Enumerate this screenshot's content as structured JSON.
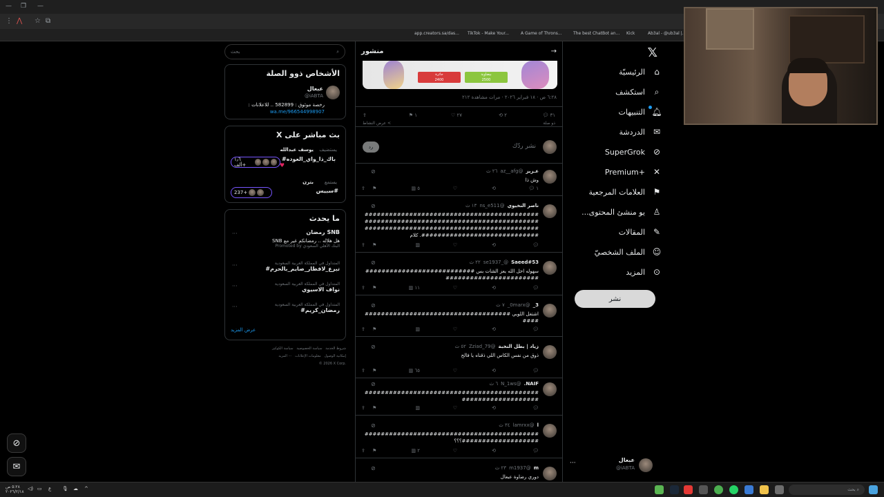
{
  "browser": {
    "bookmarks": [
      "app.creators.sa/das...",
      "TikTok - Make Your...",
      "A Game of Throns...",
      "The best ChatBot an...",
      "Kick",
      "Ab3al - @ub3al |..."
    ]
  },
  "nav": {
    "items": [
      {
        "label": "الرئيسيّة",
        "icon": "home-icon"
      },
      {
        "label": "استكشف",
        "icon": "search-icon"
      },
      {
        "label": "التنبيهات",
        "icon": "bell-icon"
      },
      {
        "label": "الدردشة",
        "icon": "mail-icon"
      },
      {
        "label": "SuperGrok",
        "icon": "grok-icon"
      },
      {
        "label": "Premium+",
        "icon": "x-icon"
      },
      {
        "label": "العلامات المرجعية",
        "icon": "bookmark-icon"
      },
      {
        "label": "...يو منشئ المحتوى",
        "icon": "creator-icon"
      },
      {
        "label": "المقالات",
        "icon": "article-icon"
      },
      {
        "label": "الملف الشخصيّ",
        "icon": "person-icon"
      },
      {
        "label": "المزيد",
        "icon": "more-icon"
      }
    ],
    "post_button": "نشر",
    "profile": {
      "name": "عبعال",
      "handle": "@iABTA"
    }
  },
  "feed": {
    "title": "منشور",
    "image_labels": [
      "جائزة",
      "بيضاوية",
      "2400",
      "2500"
    ],
    "meta": "٦:٢٨ ص · ١٨ فبراير ٢٠٢٦ · مرات مشاهدة ٢١٢",
    "actions": {
      "replies": "٣١",
      "retweets": "٢",
      "likes": "٢٧",
      "bookmarks": "١"
    },
    "activity": "عرض النشاط <",
    "sort": "ذو صلة",
    "reply_placeholder": "نشر ردّك",
    "reply_button": "رد",
    "replies": [
      {
        "name": "عـزيز",
        "handle": "@az__afg",
        "time": "٢٦ ث",
        "body": "وش ذا",
        "stats": {
          "r": "١",
          "rt": "",
          "l": "",
          "v": "٥"
        }
      },
      {
        "name": "ناصر النخيوي",
        "handle": "@ns_e511",
        "time": "١٣ ث",
        "body": "##############################################################################################################################################################. كلام",
        "stats": {
          "r": "",
          "rt": "",
          "l": "",
          "v": ""
        }
      },
      {
        "name": "Saeed#53",
        "handle": "@_se1937",
        "time": "٢٢ ث",
        "body": "سهوله احل الله يعز الشات بس ##################################################",
        "stats": {
          "r": "",
          "rt": "",
          "l": "",
          "v": "١١"
        }
      },
      {
        "name": "3_",
        "handle": "@0marx_",
        "time": "٧ ث",
        "body": "اشتغل اللوبي ########################################",
        "stats": {
          "r": "",
          "rt": "",
          "l": "",
          "v": ""
        }
      },
      {
        "name": "زياد | بطل النخبة",
        "handle": "@Zziad_79",
        "time": "٥٢ ث",
        "body": "ذوق من نفس الكاس اللي ذقناه يا فالح",
        "stats": {
          "r": "",
          "rt": "",
          "l": "",
          "v": "٦٥"
        }
      },
      {
        "name": "NAIF.",
        "handle": "@N_1ws",
        "time": "٦ ث",
        "body": "##############################################################",
        "stats": {
          "r": "",
          "rt": "",
          "l": "",
          "v": ""
        }
      },
      {
        "name": "l",
        "handle": "@lamrxx",
        "time": "٣٤ ث",
        "body": "##############################################################؟؟؟",
        "stats": {
          "r": "",
          "rt": "",
          "l": "",
          "v": "٢"
        }
      },
      {
        "name": "m",
        "handle": "@m1937",
        "time": "٢٣ ث",
        "body": "دوري رضاوة عبعال",
        "stats": {
          "r": "",
          "rt": "",
          "l": "",
          "v": ""
        }
      }
    ]
  },
  "sidebar": {
    "search_placeholder": "بحث",
    "relevant": {
      "title": "الأشخاص ذوو الصلة",
      "name": "عبعال",
      "handle": "@iABTA",
      "bio": "رخصة موثوق : 582899 .. للاعلانات :",
      "link": "wa.me/966544998907"
    },
    "live": {
      "title": "X بث مباشر على",
      "items": [
        {
          "host": "يوسف عبدالله",
          "tag": "يستضيف",
          "text": "#باك_ذا_واي_العوده",
          "count": "١٫٦ ألف+"
        },
        {
          "host": "بترن",
          "tag": "يستمع",
          "text": "سبيس#",
          "count": "237+"
        }
      ]
    },
    "trends": {
      "title": "ما يحدث",
      "items": [
        {
          "cat": "",
          "name": "رمضان SNB",
          "sub": "SNB هل هلاله .. رمضانكم غير مع",
          "promo": "Promoted by البنك الأهلي السعودي"
        },
        {
          "cat": "المتداول في المملكة العربية السعودية",
          "name": "#تبرع_لافطار_صايم_بالحرم",
          "sub": "",
          "promo": ""
        },
        {
          "cat": "المتداول في المملكة العربية السعودية",
          "name": "نواف الاسيوي",
          "sub": "",
          "promo": ""
        },
        {
          "cat": "المتداول في المملكة العربية السعودية",
          "name": "#رمضان_كريم",
          "sub": "",
          "promo": ""
        }
      ],
      "more": "عرض المزيد"
    },
    "footer": [
      "شروط الخدمة",
      "سياسة الخصوصية",
      "سياسة الكوكيز",
      "إمكانية الوصول",
      "معلومات الإعلانات",
      "··· المزيد",
      "© 2026 X Corp."
    ]
  },
  "taskbar": {
    "search": "بحث",
    "time": "٥:٢٨ ص",
    "date": "٢٠٢٦/٢/١٨"
  }
}
